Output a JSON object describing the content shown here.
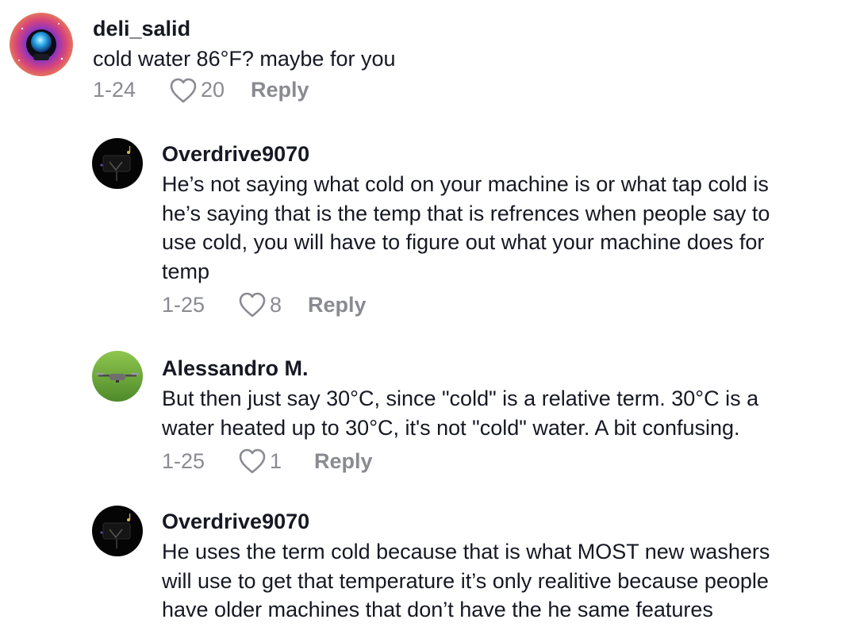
{
  "comments": [
    {
      "username": "deli_salid",
      "text": "cold water 86°F? maybe for you",
      "date": "1-24",
      "likes": "20",
      "reply_label": "Reply",
      "avatar_icon": "galaxy-astronaut-avatar"
    },
    {
      "username": "Overdrive9070",
      "text": "He’s not saying what cold on your machine is or what tap cold is\nhe’s saying that is the temp that is refrences when people say to\nuse cold, you will have to figure out what your machine does for\ntemp",
      "date": "1-25",
      "likes": "8",
      "reply_label": "Reply",
      "avatar_icon": "dark-music-avatar"
    },
    {
      "username": "Alessandro M.",
      "text": "But then just say 30°C, since \"cold\" is a relative term. 30°C is a\nwater heated up to 30°C, it's not \"cold\" water. A bit confusing.",
      "date": "1-25",
      "likes": "1",
      "reply_label": "Reply",
      "avatar_icon": "drone-avatar"
    },
    {
      "username": "Overdrive9070",
      "text": "He uses the term cold because that is what MOST new washers\nwill use to get that temperature it’s only realitive because people\nhave older machines that don’t have the he same features",
      "date": "",
      "likes": "",
      "reply_label": "",
      "avatar_icon": "dark-music-avatar"
    }
  ],
  "colors": {
    "text": "#161823",
    "muted": "#8a8b91",
    "background": "#ffffff"
  }
}
